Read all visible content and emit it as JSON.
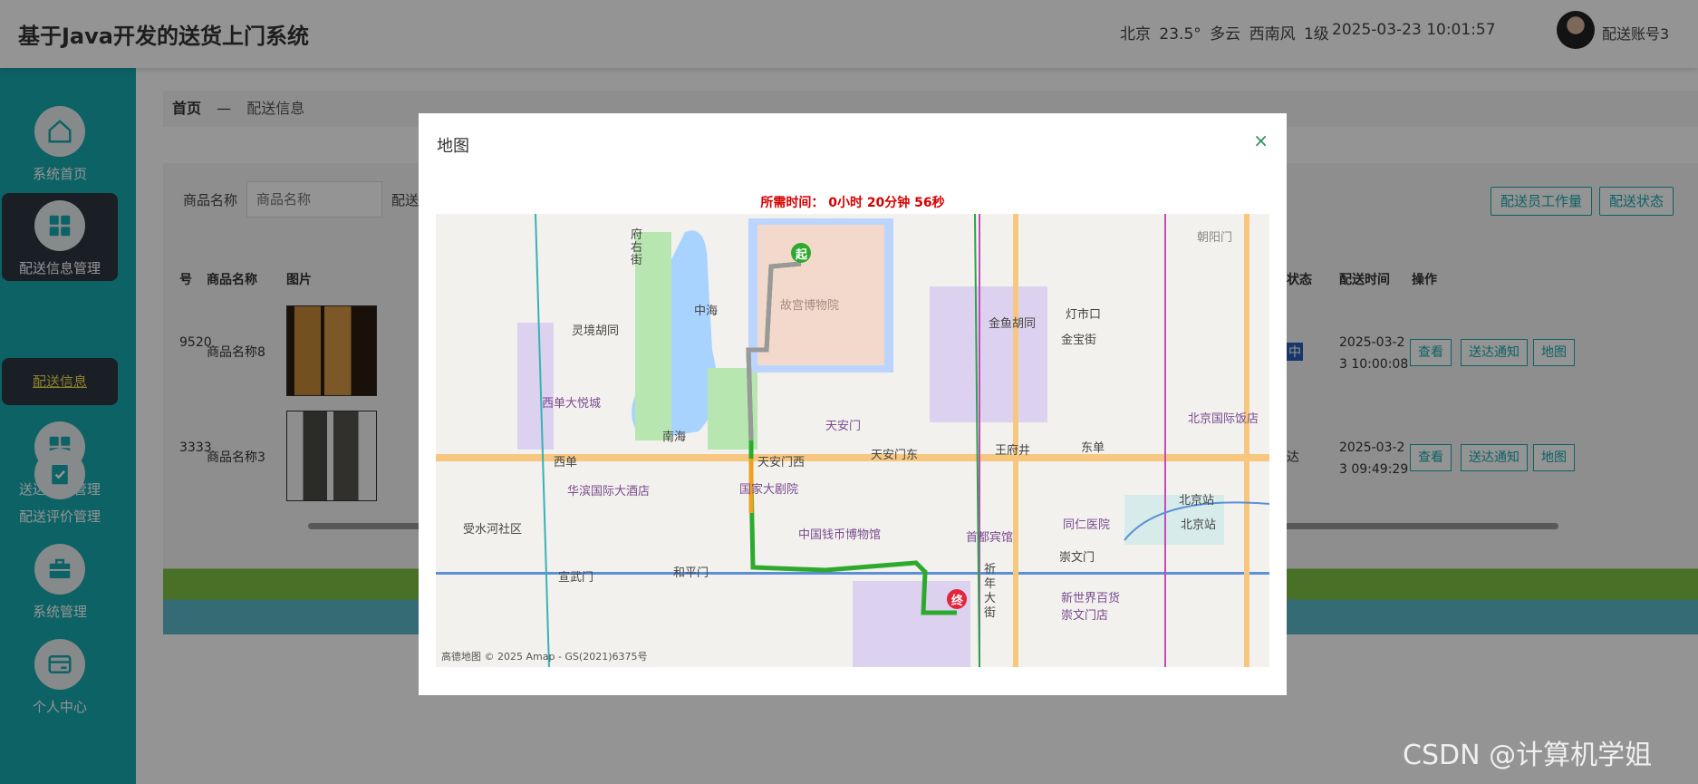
{
  "header": {
    "app_title": "基于Java开发的送货上门系统",
    "weather": "北京 23.5° 多云 西南风 1级",
    "datetime": "2025-03-23 10:01:57",
    "account": "配送账号3"
  },
  "sidebar": {
    "items": [
      {
        "label": "系统首页",
        "icon": "home-icon"
      },
      {
        "label": "配送信息管理",
        "icon": "grid-icon"
      },
      {
        "label": "送达通知管理",
        "icon": "grid-icon"
      },
      {
        "label": "配送评价管理",
        "icon": "clipboard-check-icon"
      },
      {
        "label": "系统管理",
        "icon": "briefcase-icon"
      },
      {
        "label": "个人中心",
        "icon": "card-icon"
      }
    ],
    "sub_item": "配送信息"
  },
  "breadcrumb": {
    "home": "首页",
    "separator": "—",
    "current": "配送信息"
  },
  "search": {
    "label": "商品名称",
    "placeholder": "商品名称",
    "label2": "配送"
  },
  "actions": {
    "workload_button": "配送员工作量",
    "status_button": "配送状态"
  },
  "table": {
    "headers": {
      "order": "号",
      "product": "商品名称",
      "image": "图片",
      "status": "状态",
      "time": "配送时间",
      "ops": "操作"
    },
    "rows": [
      {
        "order_no": "9520",
        "product": "商品名称8",
        "status": "中",
        "time_line1": "2025-03-2",
        "time_line2": "3 10:00:08"
      },
      {
        "order_no": "3333",
        "product": "商品名称3",
        "status": "达",
        "time_line1": "2025-03-2",
        "time_line2": "3 09:49:29"
      }
    ],
    "row_buttons": {
      "view": "查看",
      "notify": "送达通知",
      "map": "地图"
    }
  },
  "modal": {
    "title": "地图",
    "close": "×",
    "route_time": "所需时间： 0小时 20分钟 56秒",
    "copyright": "高德地图 © 2025 Amap - GS(2021)6375号",
    "map_labels": {
      "palace": "故宫博物院",
      "zhonghai": "中海",
      "nanhai": "南海",
      "tiananmen": "天安门",
      "tiananmen_west": "天安门西",
      "tiananmen_east": "天安门东",
      "wangfujing": "王府井",
      "dongdan": "东单",
      "xidan": "西单",
      "lingjing": "灵境胡同",
      "xidan_joy": "西单大悦城",
      "huabin": "华滨国际大酒店",
      "theater": "国家大剧院",
      "coin_museum": "中国钱币博物馆",
      "capital_hotel": "首都宾馆",
      "tongren": "同仁医院",
      "beijing_station": "北京站",
      "beijing_station2": "北京站",
      "chongwenmen": "崇文门",
      "hepingmen": "和平门",
      "xuanwumen": "宣武门",
      "jinyu": "金鱼胡同",
      "dengshikou": "灯市口",
      "jinbao": "金宝街",
      "beijing_intl": "北京国际饭店",
      "new_world": "新世界百货\n崇文门店",
      "chaoyangmen": "朝阳门",
      "fuyou": "府右街",
      "qinian": "祈年大街",
      "shouhe": "受水河社区",
      "start": "起",
      "end": "终"
    }
  },
  "watermark": "CSDN @计算机学姐"
}
